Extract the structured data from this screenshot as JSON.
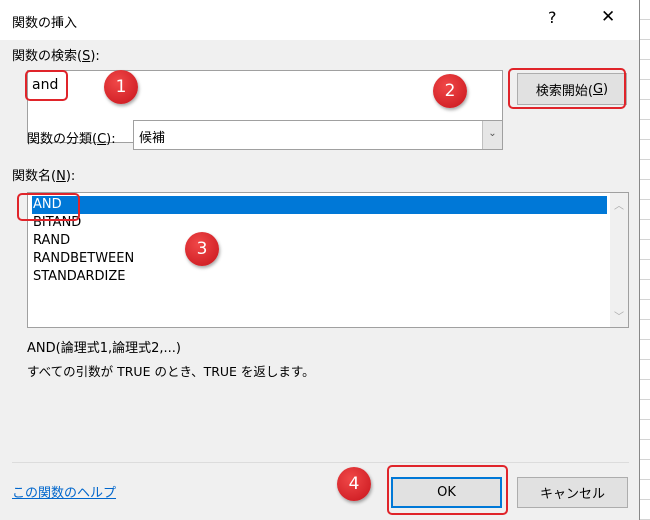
{
  "title": "関数の挿入",
  "help_glyph": "?",
  "close_glyph": "✕",
  "search": {
    "label": "関数の検索(",
    "accel": "S",
    "label_end": "):",
    "value": "and",
    "button_label": "検索開始(",
    "button_accel": "G",
    "button_end": ")"
  },
  "category": {
    "label": "関数の分類(",
    "accel": "C",
    "label_end": "):",
    "value": "候補"
  },
  "list": {
    "label": "関数名(",
    "accel": "N",
    "label_end": "):",
    "items": [
      "AND",
      "BITAND",
      "RAND",
      "RANDBETWEEN",
      "STANDARDIZE"
    ],
    "selected": 0
  },
  "syntax": "AND(論理式1,論理式2,...)",
  "description": "すべての引数が TRUE のとき、TRUE を返します。",
  "help_link": "この関数のヘルプ",
  "ok_label": "OK",
  "cancel_label": "キャンセル",
  "annotations": [
    "1",
    "2",
    "3",
    "4"
  ],
  "colors": {
    "selection": "#0078d7",
    "annotation": "#e0242a",
    "link": "#0066cc"
  }
}
